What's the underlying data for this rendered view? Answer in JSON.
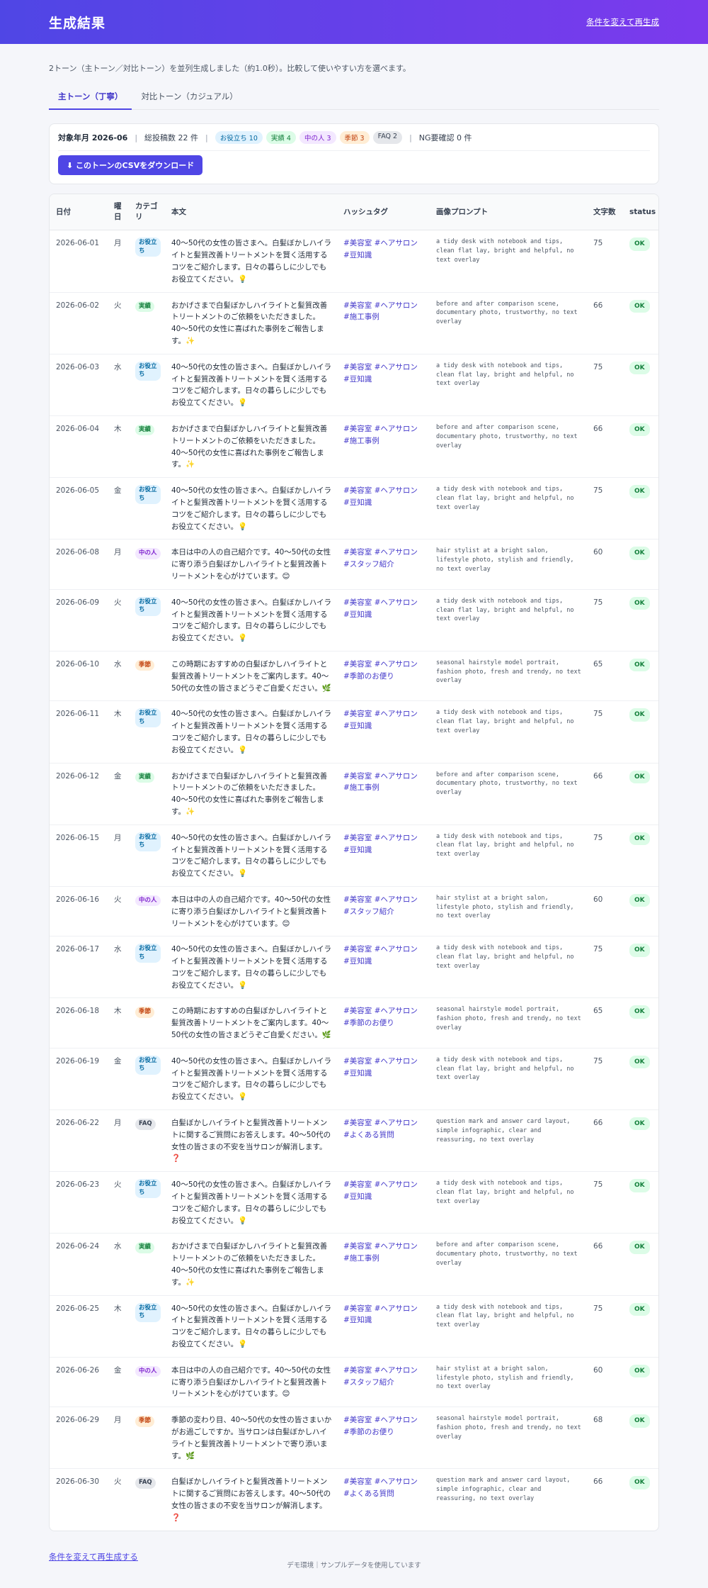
{
  "header": {
    "title": "生成結果",
    "regenerate_link": "条件を変えて再生成"
  },
  "description": "2トーン（主トーン／対比トーン）を並列生成しました（約1.0秒）。比較して使いやすい方を選べます。",
  "tabs": [
    {
      "label": "主トーン（丁寧）"
    },
    {
      "label": "対比トーン（カジュアル）"
    }
  ],
  "summary": {
    "month_label": "対象年月 2026-06",
    "total_label": "総投稿数 22 件",
    "badges": [
      {
        "label": "お役立ち 10",
        "bg": "#e0f2fe",
        "fg": "#0369a1"
      },
      {
        "label": "実績 4",
        "bg": "#dcfce7",
        "fg": "#15803d"
      },
      {
        "label": "中の人 3",
        "bg": "#f3e8ff",
        "fg": "#7e22ce"
      },
      {
        "label": "季節 3",
        "bg": "#ffedd5",
        "fg": "#c2410c"
      },
      {
        "label": "FAQ 2",
        "bg": "#e5e7eb",
        "fg": "#374151"
      }
    ],
    "ng_label": "NG要確認 0 件",
    "download_button": "⬇ このトーンのCSVをダウンロード"
  },
  "table": {
    "headers": [
      "日付",
      "曜日",
      "カテゴリ",
      "本文",
      "ハッシュタグ",
      "画像プロンプト",
      "文字数",
      "status"
    ],
    "rows": [
      {
        "date": "2026-06-01",
        "dow": "月",
        "category": "お役立ち",
        "cat_class": "help",
        "body": "40〜50代の女性の皆さまへ。白髪ぼかしハイライトと髪質改善トリートメントを賢く活用するコツをご紹介します。日々の暮らしに少しでもお役立てください。💡",
        "tags": "#美容室 #ヘアサロン #豆知識",
        "prompt": "a tidy desk with notebook and tips, clean flat lay, bright and helpful, no text overlay",
        "chars": "75",
        "status": "OK"
      },
      {
        "date": "2026-06-02",
        "dow": "火",
        "category": "実績",
        "cat_class": "results",
        "body": "おかげさまで白髪ぼかしハイライトと髪質改善トリートメントのご依頼をいただきました。40〜50代の女性に喜ばれた事例をご報告します。✨",
        "tags": "#美容室 #ヘアサロン #施工事例",
        "prompt": "before and after comparison scene, documentary photo, trustworthy, no text overlay",
        "chars": "66",
        "status": "OK"
      },
      {
        "date": "2026-06-03",
        "dow": "水",
        "category": "お役立ち",
        "cat_class": "help",
        "body": "40〜50代の女性の皆さまへ。白髪ぼかしハイライトと髪質改善トリートメントを賢く活用するコツをご紹介します。日々の暮らしに少しでもお役立てください。💡",
        "tags": "#美容室 #ヘアサロン #豆知識",
        "prompt": "a tidy desk with notebook and tips, clean flat lay, bright and helpful, no text overlay",
        "chars": "75",
        "status": "OK"
      },
      {
        "date": "2026-06-04",
        "dow": "木",
        "category": "実績",
        "cat_class": "results",
        "body": "おかげさまで白髪ぼかしハイライトと髪質改善トリートメントのご依頼をいただきました。40〜50代の女性に喜ばれた事例をご報告します。✨",
        "tags": "#美容室 #ヘアサロン #施工事例",
        "prompt": "before and after comparison scene, documentary photo, trustworthy, no text overlay",
        "chars": "66",
        "status": "OK"
      },
      {
        "date": "2026-06-05",
        "dow": "金",
        "category": "お役立ち",
        "cat_class": "help",
        "body": "40〜50代の女性の皆さまへ。白髪ぼかしハイライトと髪質改善トリートメントを賢く活用するコツをご紹介します。日々の暮らしに少しでもお役立てください。💡",
        "tags": "#美容室 #ヘアサロン #豆知識",
        "prompt": "a tidy desk with notebook and tips, clean flat lay, bright and helpful, no text overlay",
        "chars": "75",
        "status": "OK"
      },
      {
        "date": "2026-06-08",
        "dow": "月",
        "category": "中の人",
        "cat_class": "person",
        "body": "本日は中の人の自己紹介です。40〜50代の女性に寄り添う白髪ぼかしハイライトと髪質改善トリートメントを心がけています。😊",
        "tags": "#美容室 #ヘアサロン #スタッフ紹介",
        "prompt": "hair stylist at a bright salon, lifestyle photo, stylish and friendly, no text overlay",
        "chars": "60",
        "status": "OK"
      },
      {
        "date": "2026-06-09",
        "dow": "火",
        "category": "お役立ち",
        "cat_class": "help",
        "body": "40〜50代の女性の皆さまへ。白髪ぼかしハイライトと髪質改善トリートメントを賢く活用するコツをご紹介します。日々の暮らしに少しでもお役立てください。💡",
        "tags": "#美容室 #ヘアサロン #豆知識",
        "prompt": "a tidy desk with notebook and tips, clean flat lay, bright and helpful, no text overlay",
        "chars": "75",
        "status": "OK"
      },
      {
        "date": "2026-06-10",
        "dow": "水",
        "category": "季節",
        "cat_class": "season",
        "body": "この時期におすすめの白髪ぼかしハイライトと髪質改善トリートメントをご案内します。40〜50代の女性の皆さまどうぞご自愛ください。🌿",
        "tags": "#美容室 #ヘアサロン #季節のお便り",
        "prompt": "seasonal hairstyle model portrait, fashion photo, fresh and trendy, no text overlay",
        "chars": "65",
        "status": "OK"
      },
      {
        "date": "2026-06-11",
        "dow": "木",
        "category": "お役立ち",
        "cat_class": "help",
        "body": "40〜50代の女性の皆さまへ。白髪ぼかしハイライトと髪質改善トリートメントを賢く活用するコツをご紹介します。日々の暮らしに少しでもお役立てください。💡",
        "tags": "#美容室 #ヘアサロン #豆知識",
        "prompt": "a tidy desk with notebook and tips, clean flat lay, bright and helpful, no text overlay",
        "chars": "75",
        "status": "OK"
      },
      {
        "date": "2026-06-12",
        "dow": "金",
        "category": "実績",
        "cat_class": "results",
        "body": "おかげさまで白髪ぼかしハイライトと髪質改善トリートメントのご依頼をいただきました。40〜50代の女性に喜ばれた事例をご報告します。✨",
        "tags": "#美容室 #ヘアサロン #施工事例",
        "prompt": "before and after comparison scene, documentary photo, trustworthy, no text overlay",
        "chars": "66",
        "status": "OK"
      },
      {
        "date": "2026-06-15",
        "dow": "月",
        "category": "お役立ち",
        "cat_class": "help",
        "body": "40〜50代の女性の皆さまへ。白髪ぼかしハイライトと髪質改善トリートメントを賢く活用するコツをご紹介します。日々の暮らしに少しでもお役立てください。💡",
        "tags": "#美容室 #ヘアサロン #豆知識",
        "prompt": "a tidy desk with notebook and tips, clean flat lay, bright and helpful, no text overlay",
        "chars": "75",
        "status": "OK"
      },
      {
        "date": "2026-06-16",
        "dow": "火",
        "category": "中の人",
        "cat_class": "person",
        "body": "本日は中の人の自己紹介です。40〜50代の女性に寄り添う白髪ぼかしハイライトと髪質改善トリートメントを心がけています。😊",
        "tags": "#美容室 #ヘアサロン #スタッフ紹介",
        "prompt": "hair stylist at a bright salon, lifestyle photo, stylish and friendly, no text overlay",
        "chars": "60",
        "status": "OK"
      },
      {
        "date": "2026-06-17",
        "dow": "水",
        "category": "お役立ち",
        "cat_class": "help",
        "body": "40〜50代の女性の皆さまへ。白髪ぼかしハイライトと髪質改善トリートメントを賢く活用するコツをご紹介します。日々の暮らしに少しでもお役立てください。💡",
        "tags": "#美容室 #ヘアサロン #豆知識",
        "prompt": "a tidy desk with notebook and tips, clean flat lay, bright and helpful, no text overlay",
        "chars": "75",
        "status": "OK"
      },
      {
        "date": "2026-06-18",
        "dow": "木",
        "category": "季節",
        "cat_class": "season",
        "body": "この時期におすすめの白髪ぼかしハイライトと髪質改善トリートメントをご案内します。40〜50代の女性の皆さまどうぞご自愛ください。🌿",
        "tags": "#美容室 #ヘアサロン #季節のお便り",
        "prompt": "seasonal hairstyle model portrait, fashion photo, fresh and trendy, no text overlay",
        "chars": "65",
        "status": "OK"
      },
      {
        "date": "2026-06-19",
        "dow": "金",
        "category": "お役立ち",
        "cat_class": "help",
        "body": "40〜50代の女性の皆さまへ。白髪ぼかしハイライトと髪質改善トリートメントを賢く活用するコツをご紹介します。日々の暮らしに少しでもお役立てください。💡",
        "tags": "#美容室 #ヘアサロン #豆知識",
        "prompt": "a tidy desk with notebook and tips, clean flat lay, bright and helpful, no text overlay",
        "chars": "75",
        "status": "OK"
      },
      {
        "date": "2026-06-22",
        "dow": "月",
        "category": "FAQ",
        "cat_class": "faq",
        "body": "白髪ぼかしハイライトと髪質改善トリートメントに関するご質問にお答えします。40〜50代の女性の皆さまの不安を当サロンが解消します。❓",
        "tags": "#美容室 #ヘアサロン #よくある質問",
        "prompt": "question mark and answer card layout, simple infographic, clear and reassuring, no text overlay",
        "chars": "66",
        "status": "OK"
      },
      {
        "date": "2026-06-23",
        "dow": "火",
        "category": "お役立ち",
        "cat_class": "help",
        "body": "40〜50代の女性の皆さまへ。白髪ぼかしハイライトと髪質改善トリートメントを賢く活用するコツをご紹介します。日々の暮らしに少しでもお役立てください。💡",
        "tags": "#美容室 #ヘアサロン #豆知識",
        "prompt": "a tidy desk with notebook and tips, clean flat lay, bright and helpful, no text overlay",
        "chars": "75",
        "status": "OK"
      },
      {
        "date": "2026-06-24",
        "dow": "水",
        "category": "実績",
        "cat_class": "results",
        "body": "おかげさまで白髪ぼかしハイライトと髪質改善トリートメントのご依頼をいただきました。40〜50代の女性に喜ばれた事例をご報告します。✨",
        "tags": "#美容室 #ヘアサロン #施工事例",
        "prompt": "before and after comparison scene, documentary photo, trustworthy, no text overlay",
        "chars": "66",
        "status": "OK"
      },
      {
        "date": "2026-06-25",
        "dow": "木",
        "category": "お役立ち",
        "cat_class": "help",
        "body": "40〜50代の女性の皆さまへ。白髪ぼかしハイライトと髪質改善トリートメントを賢く活用するコツをご紹介します。日々の暮らしに少しでもお役立てください。💡",
        "tags": "#美容室 #ヘアサロン #豆知識",
        "prompt": "a tidy desk with notebook and tips, clean flat lay, bright and helpful, no text overlay",
        "chars": "75",
        "status": "OK"
      },
      {
        "date": "2026-06-26",
        "dow": "金",
        "category": "中の人",
        "cat_class": "person",
        "body": "本日は中の人の自己紹介です。40〜50代の女性に寄り添う白髪ぼかしハイライトと髪質改善トリートメントを心がけています。😊",
        "tags": "#美容室 #ヘアサロン #スタッフ紹介",
        "prompt": "hair stylist at a bright salon, lifestyle photo, stylish and friendly, no text overlay",
        "chars": "60",
        "status": "OK"
      },
      {
        "date": "2026-06-29",
        "dow": "月",
        "category": "季節",
        "cat_class": "season",
        "body": "季節の変わり目、40〜50代の女性の皆さまいかがお過ごしですか。当サロンは白髪ぼかしハイライトと髪質改善トリートメントで寄り添います。🌿",
        "tags": "#美容室 #ヘアサロン #季節のお便り",
        "prompt": "seasonal hairstyle model portrait, fashion photo, fresh and trendy, no text overlay",
        "chars": "68",
        "status": "OK"
      },
      {
        "date": "2026-06-30",
        "dow": "火",
        "category": "FAQ",
        "cat_class": "faq",
        "body": "白髪ぼかしハイライトと髪質改善トリートメントに関するご質問にお答えします。40〜50代の女性の皆さまの不安を当サロンが解消します。❓",
        "tags": "#美容室 #ヘアサロン #よくある質問",
        "prompt": "question mark and answer card layout, simple infographic, clear and reassuring, no text overlay",
        "chars": "66",
        "status": "OK"
      }
    ]
  },
  "bottom_link": "条件を変えて再生成する",
  "footer": "デモ環境｜サンプルデータを使用しています"
}
